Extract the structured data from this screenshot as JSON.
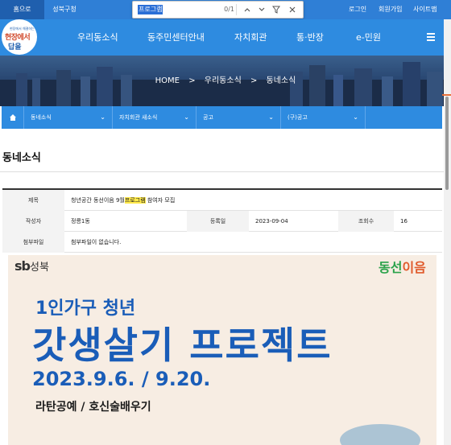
{
  "topbar": {
    "home_tab": "홈으로",
    "district_tab": "성북구청",
    "login": "로그인",
    "signup": "회원가입",
    "sitemap": "사이트맵"
  },
  "find_bar": {
    "query": "프로그램",
    "count": "0/1"
  },
  "logo": {
    "line1": "현장에서 해결하는",
    "line2": "현장에서",
    "line3": "답을"
  },
  "main_nav": [
    "우리동소식",
    "동주민센터안내",
    "자치회관",
    "통·반장",
    "e-민원"
  ],
  "breadcrumb": {
    "home": "HOME",
    "sep": ">",
    "level1": "우리동소식",
    "level2": "동네소식"
  },
  "sub_nav": [
    "동네소식",
    "자치회관 새소식",
    "공고",
    "(구)공고"
  ],
  "page_title": "동네소식",
  "post": {
    "subject_label": "제목",
    "subject_before": "청년공간 동선이음 9월",
    "subject_highlight": "프로그램",
    "subject_after": " 참여자 모집",
    "author_label": "작성자",
    "author": "정릉1동",
    "date_label": "등록일",
    "date": "2023-09-04",
    "views_label": "조회수",
    "views": "16",
    "attach_label": "첨부파일",
    "attach_value": "첨부파일이 없습니다."
  },
  "poster": {
    "sb_mark": "sb",
    "sb_text": "성북",
    "dongsun": "동선",
    "dongsun_accent": "이음",
    "line1": "1인가구 청년",
    "line2": "갓생살기 프로젝트",
    "line3": "2023.9.6. / 9.20.",
    "line4": "라탄공예 / 호신술배우기"
  },
  "colors": {
    "header_blue": "#2e8be0",
    "topbar_blue": "#2f7fd6",
    "poster_blue": "#1a5db8",
    "highlight": "#ffe94a"
  }
}
